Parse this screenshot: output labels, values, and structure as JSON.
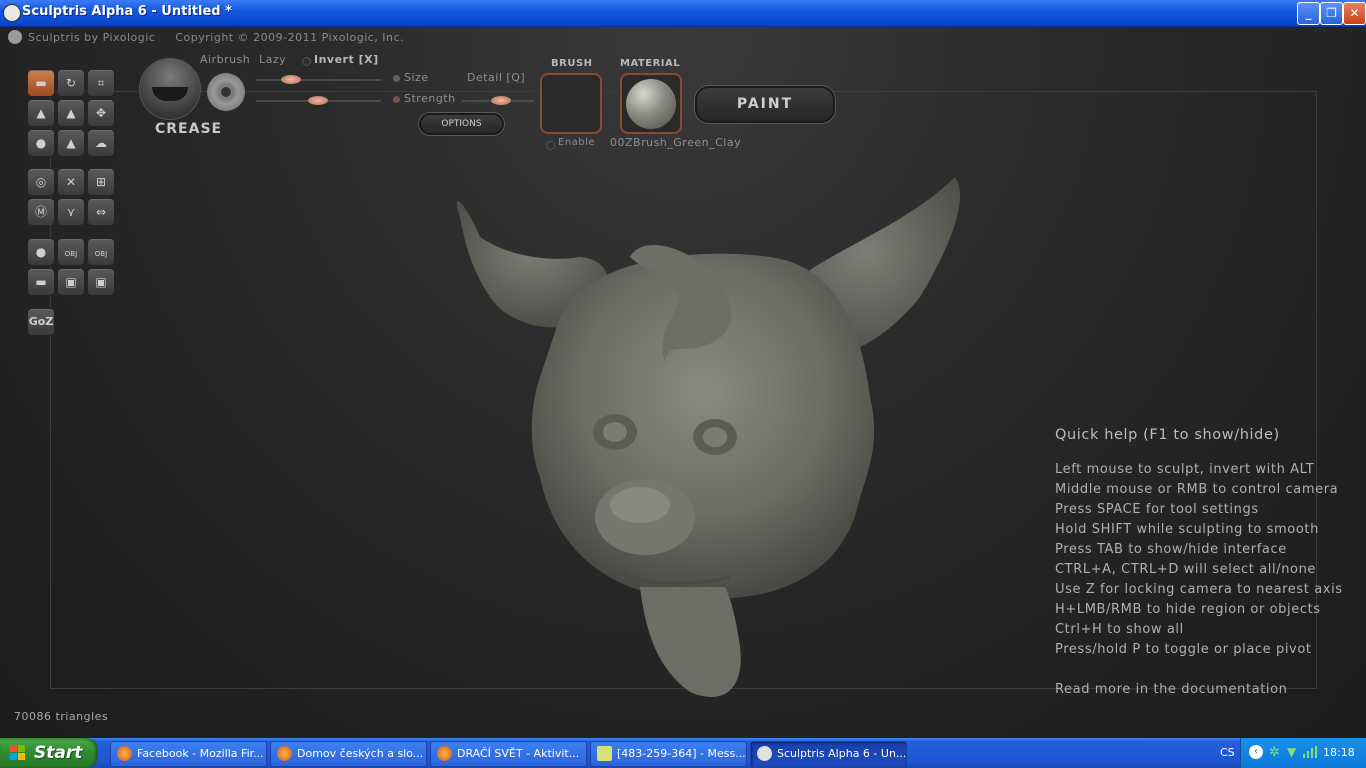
{
  "window": {
    "title": "Sculptris Alpha 6 - Untitled *"
  },
  "app_header": {
    "brand": "Sculptris by Pixologic",
    "copyright": "Copyright © 2009-2011 Pixologic, Inc."
  },
  "toolbar": {
    "brush_name": "CREASE",
    "airbrush_label": "Airbrush",
    "lazy_label": "Lazy",
    "invert_label": "Invert [X]",
    "size_label": "Size",
    "strength_label": "Strength",
    "detail_label": "Detail [Q]",
    "options_label": "OPTIONS",
    "brush_section": "BRUSH",
    "material_section": "MATERIAL",
    "enable_label": "Enable",
    "material_name": "00ZBrush_Green_Clay",
    "paint_label": "PAINT"
  },
  "tools": {
    "goz_label": "GoZ",
    "obj_label": "OBJ"
  },
  "quick_help": {
    "heading": "Quick help (F1 to show/hide)",
    "lines": [
      "Left mouse to sculpt, invert with ALT",
      "Middle mouse or RMB to control camera",
      "Press SPACE for tool settings",
      "Hold SHIFT while sculpting to smooth",
      "Press TAB to show/hide interface",
      "CTRL+A, CTRL+D will select all/none",
      "Use Z for locking camera to nearest axis",
      "H+LMB/RMB to hide region or objects",
      "Ctrl+H to show all",
      "Press/hold P to toggle or place pivot"
    ],
    "more": "Read more in the documentation"
  },
  "status": {
    "triangles": "70086 triangles"
  },
  "taskbar": {
    "start_label": "Start",
    "tasks": [
      {
        "label": "Facebook - Mozilla Fir...",
        "icon": "firefox-icon"
      },
      {
        "label": "Domov českých a slo...",
        "icon": "firefox-icon"
      },
      {
        "label": "DRAČÍ SVĚT - Aktivit...",
        "icon": "firefox-icon"
      },
      {
        "label": "[483-259-364] - Mess...",
        "icon": "messenger-icon"
      },
      {
        "label": "Sculptris Alpha 6 - Un...",
        "icon": "sculptris-icon"
      }
    ],
    "language": "CS",
    "clock": "18:18"
  }
}
